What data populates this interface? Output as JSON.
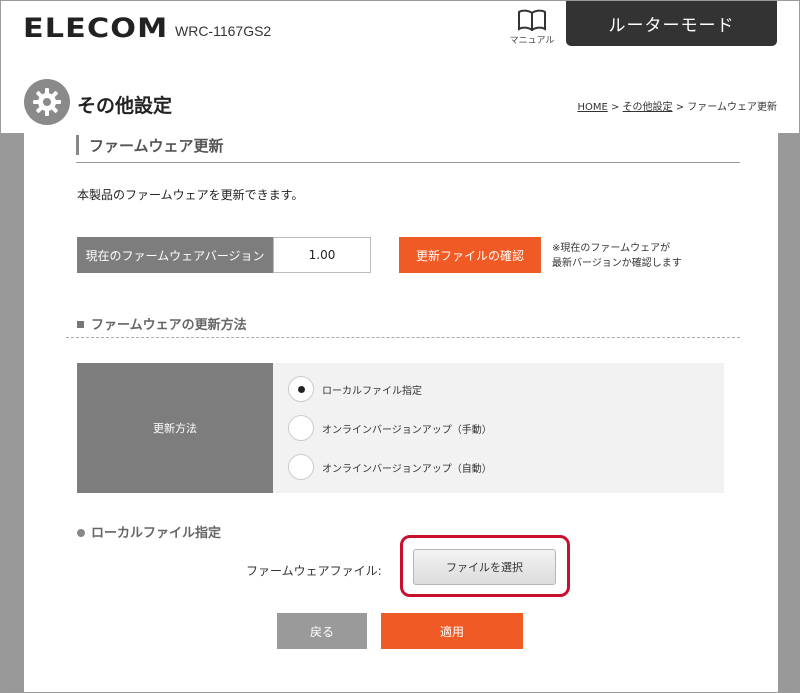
{
  "header": {
    "brand": "ELECOM",
    "model": "WRC-1167GS2",
    "manual_label": "マニュアル",
    "manual_icon": "book-icon",
    "mode_label": "ルーターモード"
  },
  "titlebar": {
    "icon": "gear-icon",
    "title": "その他設定",
    "breadcrumb": {
      "home": "HOME",
      "sep1": " > ",
      "parent": "その他設定",
      "sep2": " > ",
      "current": "ファームウェア更新"
    }
  },
  "main": {
    "section_title": "ファームウェア更新",
    "description": "本製品のファームウェアを更新できます。",
    "firmware": {
      "label": "現在のファームウェアバージョン",
      "value": "1.00",
      "check_button": "更新ファイルの確認",
      "note_line1": "※現在のファームウェアが",
      "note_line2": "最新バージョンか確認します"
    },
    "update_method": {
      "heading": "ファームウェアの更新方法",
      "label": "更新方法",
      "options": [
        {
          "label": "ローカルファイル指定",
          "selected": true
        },
        {
          "label": "オンラインバージョンアップ（手動）",
          "selected": false
        },
        {
          "label": "オンラインバージョンアップ（自動）",
          "selected": false
        }
      ]
    },
    "local_file": {
      "heading": "ローカルファイル指定",
      "field_label": "ファームウェアファイル:",
      "choose_button": "ファイルを選択"
    },
    "actions": {
      "back": "戻る",
      "apply": "適用"
    }
  },
  "colors": {
    "accent": "#f05a24",
    "dark": "#333333",
    "label_bg": "#7d7d7d",
    "highlight": "#c8102e"
  }
}
